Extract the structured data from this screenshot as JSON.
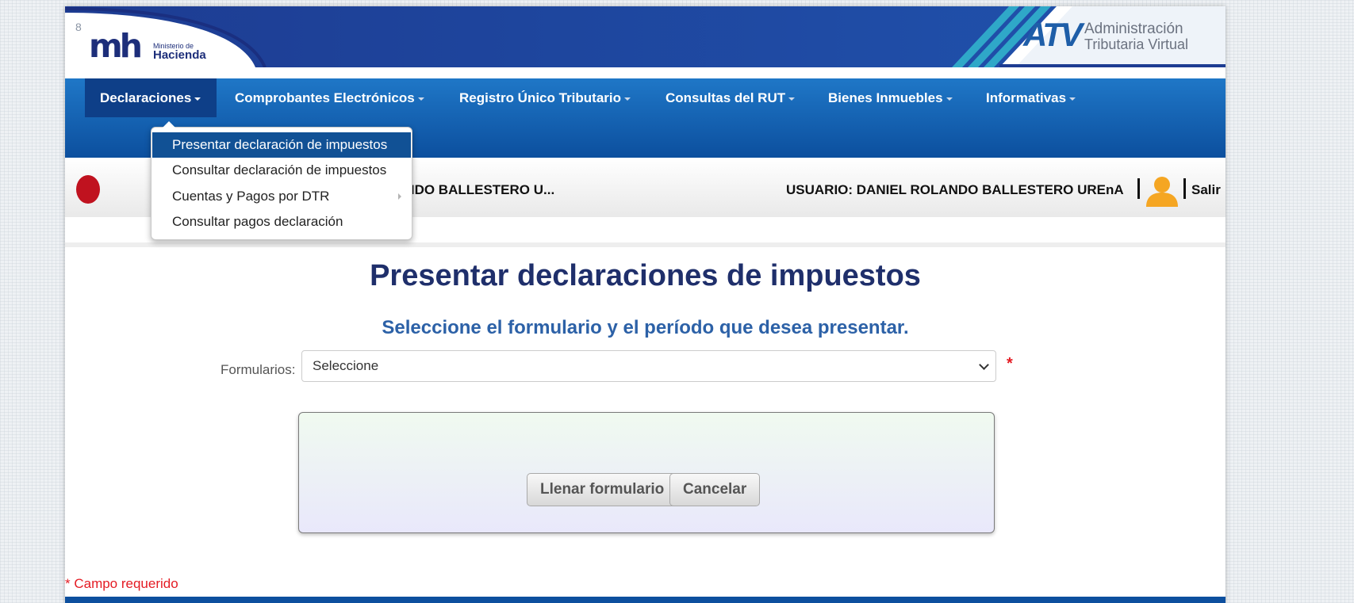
{
  "header": {
    "page_number": "8",
    "logo_mark": "mh",
    "logo_ministry": "Ministerio de",
    "logo_hacienda": "Hacienda",
    "atv_mark": "ATV",
    "atv_line1": "Administración",
    "atv_line2": "Tributaria Virtual",
    "colors": {
      "banner": "#1a4ba0",
      "accent_stripes": "#2fa8c8"
    }
  },
  "nav": {
    "items": [
      {
        "label": "Declaraciones",
        "active": true
      },
      {
        "label": "Comprobantes Electrónicos"
      },
      {
        "label": "Registro Único Tributario"
      },
      {
        "label": "Consultas del RUT"
      },
      {
        "label": "Bienes Inmuebles"
      },
      {
        "label": "Informativas"
      }
    ]
  },
  "dropdown": {
    "items": [
      {
        "label": "Presentar declaración de impuestos",
        "active": true
      },
      {
        "label": "Consultar declaración de impuestos"
      },
      {
        "label": "Cuentas y Pagos por DTR",
        "has_submenu": true
      },
      {
        "label": "Consultar pagos declaración"
      }
    ]
  },
  "userbar": {
    "taxpayer_truncated": "NIEL ROLANDO BALLESTERO U...",
    "user_label": "USUARIO: DANIEL ROLANDO BALLESTERO UREnA",
    "avatar_icon": "user-avatar-icon",
    "logout": "Salir"
  },
  "main": {
    "title": "Presentar declaraciones de impuestos",
    "subtitle": "Seleccione el formulario y el período que desea presentar.",
    "form_label": "Formularios:",
    "select_value": "Seleccione",
    "required_star": "*",
    "buttons": {
      "fill": "Llenar formulario",
      "cancel": "Cancelar"
    },
    "required_note": "* Campo requerido"
  }
}
